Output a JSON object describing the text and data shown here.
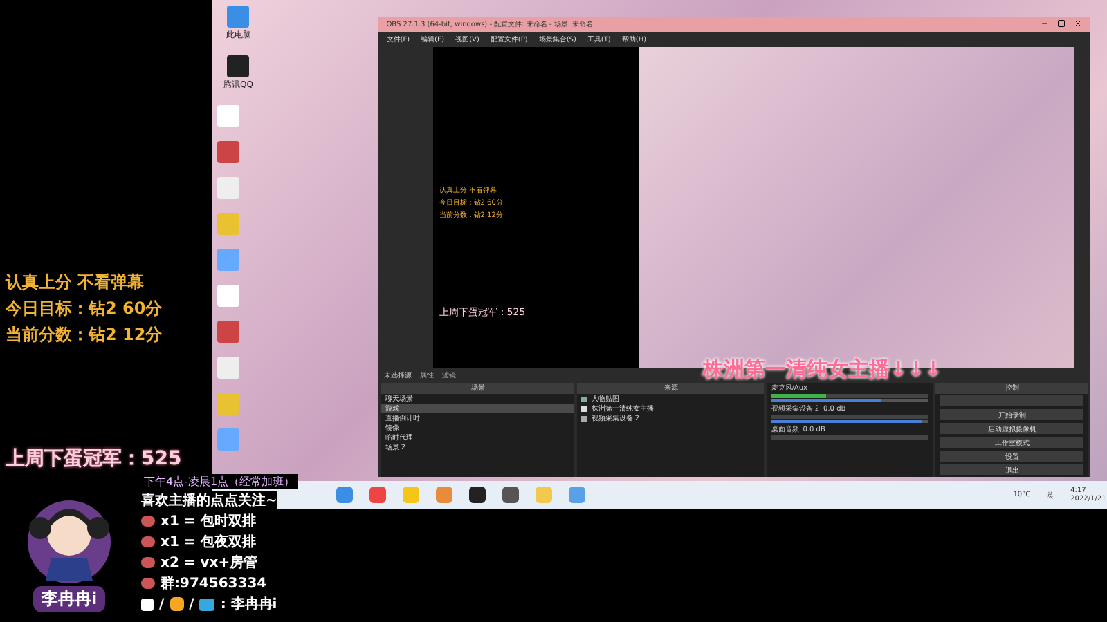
{
  "stream_overlay": {
    "status_lines": [
      "认真上分  不看弹幕",
      "今日目标：钻2 60分",
      "当前分数：钻2 12分"
    ],
    "champion": "上周下蛋冠军：525",
    "schedule": "下午4点-凌晨1点（经常加班）",
    "follow": "喜欢主播的点点关注~",
    "perks": [
      {
        "text": "x1 = 包时双排"
      },
      {
        "text": "x1 = 包夜双排"
      },
      {
        "text": "x2 = vx+房管"
      },
      {
        "text": "群:974563334"
      }
    ],
    "socials": {
      "separator_1": "/",
      "separator_2": "/",
      "name": ": 李冉冉i"
    },
    "logo": "李冉冉i",
    "banner": "株洲第一清纯女主播↓↓↓"
  },
  "desktop": {
    "icons": [
      {
        "label": "此电脑"
      },
      {
        "label": "腾讯QQ"
      }
    ],
    "taskbar": {
      "temperature": "10°C",
      "language": "英",
      "time": "4:17",
      "date": "2022/1/21"
    }
  },
  "obs": {
    "title": "OBS 27.1.3 (64-bit, windows) - 配置文件: 未命名 - 场景: 未命名",
    "menu": [
      "文件(F)",
      "编辑(E)",
      "视图(V)",
      "配置文件(P)",
      "场景集合(S)",
      "工具(T)",
      "帮助(H)"
    ],
    "preview_lines": [
      "认真上分  不看弹幕",
      "今日目标：钻2 60分",
      "当前分数：钻2 12分"
    ],
    "preview_champion": "上周下蛋冠军：525",
    "source_bar": {
      "label": "未选择源",
      "buttons": [
        "属性",
        "滤镜"
      ]
    },
    "scenes": {
      "title": "场景",
      "items": [
        {
          "label": "聊天场景",
          "selected": false
        },
        {
          "label": "游戏",
          "selected": true
        },
        {
          "label": "直播倒计时",
          "selected": false
        },
        {
          "label": "镜像",
          "selected": false
        },
        {
          "label": "临时代理",
          "selected": false
        },
        {
          "label": "场景 2",
          "selected": false
        }
      ]
    },
    "sources": {
      "title": "来源",
      "items": [
        {
          "label": "人物贴图",
          "kind": "image"
        },
        {
          "label": "株洲第一清纯女主播",
          "kind": "text"
        },
        {
          "label": "视频采集设备 2",
          "kind": "video"
        }
      ]
    },
    "mixer": [
      {
        "name": "麦克风/Aux",
        "level": 0.35,
        "volume": {
          "level": 0.7
        }
      },
      {
        "name": "视频采集设备 2",
        "reading": "0.0 dB",
        "volume": {
          "level": 0.95
        }
      },
      {
        "name": "桌面音频",
        "reading": "0.0 dB"
      }
    ],
    "controls": {
      "title": "控制",
      "buttons": [
        "开始录制",
        "启动虚拟摄像机",
        "工作室模式",
        "设置",
        "退出"
      ]
    }
  }
}
